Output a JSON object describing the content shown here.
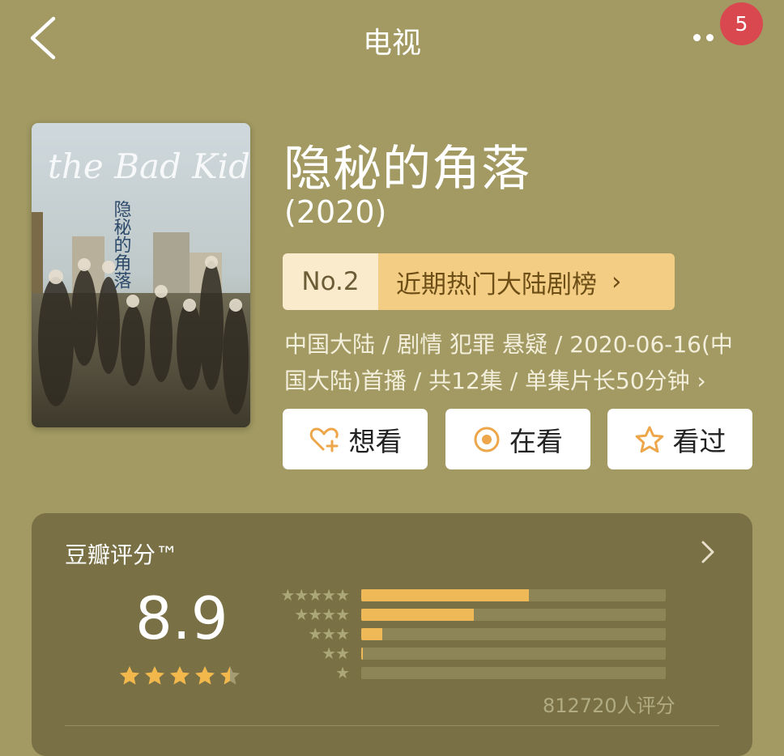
{
  "header": {
    "title": "电视",
    "notification_count": "5"
  },
  "poster": {
    "alt": "隐秘的角落 poster",
    "overlay_title": "隐秘的角落",
    "overlay_title_en": "the Bad Kids"
  },
  "show": {
    "title": "隐秘的角落",
    "year": "(2020)",
    "rank_no": "No.2",
    "rank_list": "近期热门大陆剧榜",
    "meta": "中国大陆 / 剧情 犯罪 悬疑 / 2020-06-16(中国大陆)首播 / 共12集 / 单集片长50分钟 ›"
  },
  "actions": {
    "want_label": "想看",
    "watching_label": "在看",
    "watched_label": "看过"
  },
  "rating": {
    "section_title": "豆瓣评分™",
    "score": "8.9",
    "score_stars": 4.5,
    "count_label": "812720人评分",
    "distribution": [
      {
        "stars": 5,
        "fraction": 0.55
      },
      {
        "stars": 4,
        "fraction": 0.37
      },
      {
        "stars": 3,
        "fraction": 0.07
      },
      {
        "stars": 2,
        "fraction": 0.005
      },
      {
        "stars": 1,
        "fraction": 0.0
      }
    ]
  },
  "colors": {
    "background": "#a29a62",
    "card": "#797045",
    "accent": "#efb957",
    "badge": "#d9474f"
  }
}
